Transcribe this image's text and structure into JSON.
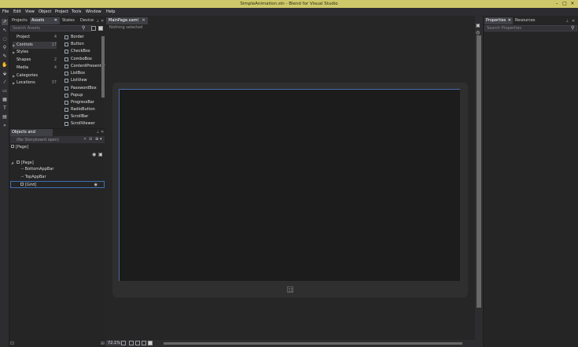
{
  "window": {
    "title": "SimpleAnimation.sln - Blend for Visual Studio",
    "colors": {
      "titlebar": "#cfc86a",
      "panel": "#252526",
      "chrome": "#2d2d30",
      "canvas": "#262626",
      "artboard": "#1c1c1c",
      "selection": "#3e6fb0"
    }
  },
  "menu": [
    "File",
    "Edit",
    "View",
    "Object",
    "Project",
    "Tools",
    "Window",
    "Help"
  ],
  "left_tabs": [
    "Projects",
    "Assets",
    "States",
    "Device"
  ],
  "assets": {
    "search_placeholder": "Search Assets",
    "categories": [
      {
        "label": "Project",
        "count": "4",
        "expandable": false
      },
      {
        "label": "Controls",
        "count": "17",
        "expandable": true,
        "selected": true
      },
      {
        "label": "Styles",
        "count": "",
        "expandable": true
      },
      {
        "label": "Shapes",
        "count": "2",
        "expandable": false
      },
      {
        "label": "Media",
        "count": "4",
        "expandable": false
      },
      {
        "label": "Categories",
        "count": "",
        "expandable": true
      },
      {
        "label": "Locations",
        "count": "37",
        "expandable": true
      }
    ],
    "controls": [
      "Border",
      "Button",
      "CheckBox",
      "ComboBox",
      "ContentPresenter",
      "ListBox",
      "ListView",
      "PasswordBox",
      "Popup",
      "ProgressBar",
      "RadioButton",
      "ScrollBar",
      "ScrollViewer"
    ]
  },
  "objects": {
    "tab": "Objects and Timeline",
    "storyboard": "(No Storyboard open)",
    "root": "[Page]",
    "tree": [
      {
        "label": "[Page]",
        "depth": 0,
        "expanded": true
      },
      {
        "label": "BottomAppBar",
        "depth": 1
      },
      {
        "label": "TopAppBar",
        "depth": 1
      },
      {
        "label": "[Grid]",
        "depth": 1,
        "selected": true
      }
    ]
  },
  "document": {
    "tab": "MainPage.xaml",
    "status": "Nothing selected",
    "zoom": "72.1%"
  },
  "right_tabs": [
    "Properties",
    "Resources"
  ],
  "properties": {
    "search_placeholder": "Search Properties"
  },
  "icons": {
    "close": "close-icon",
    "pin": "pin-icon",
    "search": "search-icon",
    "windows": "windows-logo-icon",
    "eye": "eye-icon",
    "lock": "lock-icon"
  }
}
